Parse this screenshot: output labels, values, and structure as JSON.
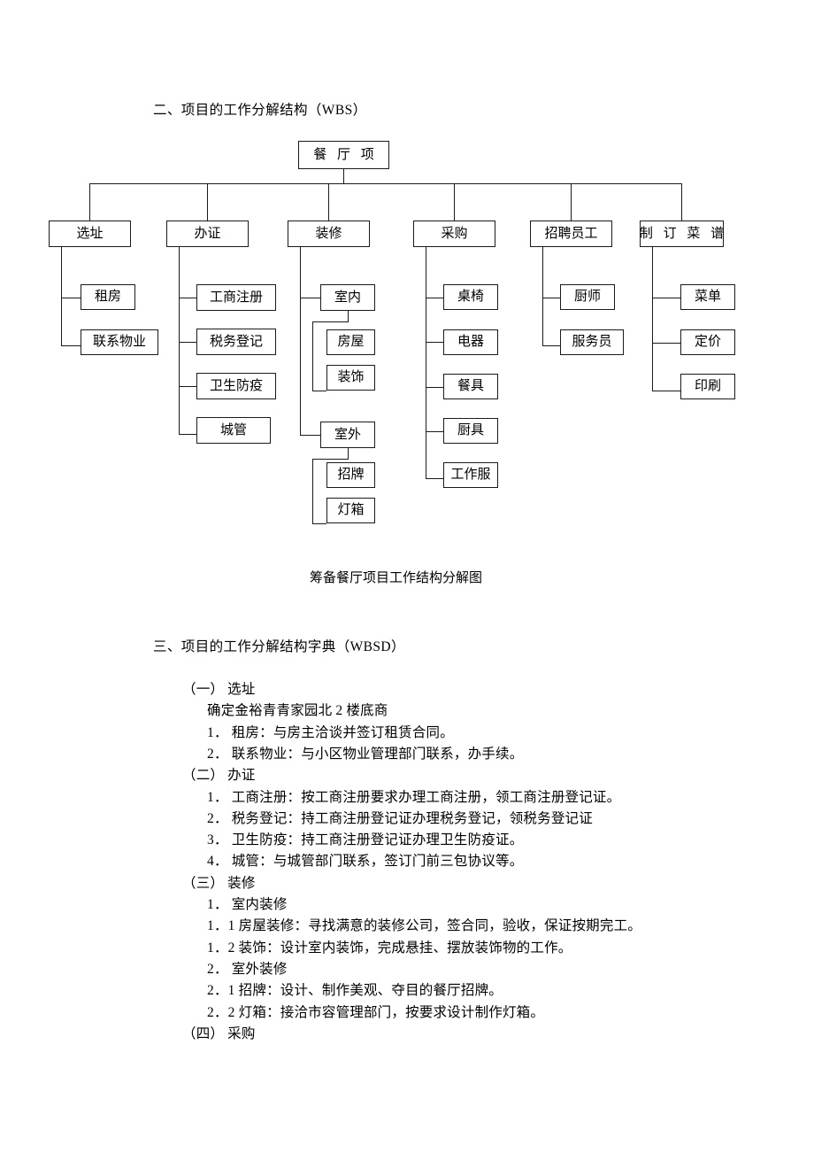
{
  "document": {
    "section_wbs_heading": "二、项目的工作分解结构（WBS）",
    "chart_caption": "筹备餐厅项目工作结构分解图",
    "section_wbsd_heading": "三、项目的工作分解结构字典（WBSD）"
  },
  "wbs": {
    "root": {
      "label": "餐 厅 项"
    },
    "level2": [
      {
        "label": "选址"
      },
      {
        "label": "办证"
      },
      {
        "label": "装修"
      },
      {
        "label": "采购"
      },
      {
        "label": "招聘员工"
      },
      {
        "label": "制 订 菜 谱"
      }
    ],
    "xuanzhi_children": [
      {
        "label": "租房"
      },
      {
        "label": "联系物业"
      }
    ],
    "banzheng_children": [
      {
        "label": "工商注册"
      },
      {
        "label": "税务登记"
      },
      {
        "label": "卫生防疫"
      },
      {
        "label": "城管"
      }
    ],
    "zhuangxiu_children": [
      {
        "label": "室内"
      },
      {
        "label": "室外"
      }
    ],
    "shinei_children": [
      {
        "label": "房屋"
      },
      {
        "label": "装饰"
      }
    ],
    "shiwai_children": [
      {
        "label": "招牌"
      },
      {
        "label": "灯箱"
      }
    ],
    "caigou_children": [
      {
        "label": "桌椅"
      },
      {
        "label": "电器"
      },
      {
        "label": "餐具"
      },
      {
        "label": "厨具"
      },
      {
        "label": "工作服"
      }
    ],
    "zhaopin_children": [
      {
        "label": "厨师"
      },
      {
        "label": "服务员"
      }
    ],
    "caipu_children": [
      {
        "label": "菜单"
      },
      {
        "label": "定价"
      },
      {
        "label": "印刷"
      }
    ]
  },
  "wbsd": {
    "lines": [
      {
        "text": "（一）  选址",
        "indent": 0
      },
      {
        "text": "确定金裕青青家园北 2 楼底商",
        "indent": 1
      },
      {
        "text": "1． 租房：与房主洽谈并签订租赁合同。",
        "indent": 1
      },
      {
        "text": "2． 联系物业：与小区物业管理部门联系，办手续。",
        "indent": 1
      },
      {
        "text": "（二）  办证",
        "indent": 0
      },
      {
        "text": "1． 工商注册：按工商注册要求办理工商注册，领工商注册登记证。",
        "indent": 1
      },
      {
        "text": "2． 税务登记：持工商注册登记证办理税务登记，领税务登记证",
        "indent": 1
      },
      {
        "text": "3． 卫生防疫：持工商注册登记证办理卫生防疫证。",
        "indent": 1
      },
      {
        "text": "4． 城管：与城管部门联系，签订门前三包协议等。",
        "indent": 1
      },
      {
        "text": "（三）  装修",
        "indent": 0
      },
      {
        "text": "1． 室内装修",
        "indent": 1
      },
      {
        "text": "1．1   房屋装修：寻找满意的装修公司，签合同，验收，保证按期完工。",
        "indent": 1
      },
      {
        "text": "1．2   装饰：设计室内装饰，完成悬挂、摆放装饰物的工作。",
        "indent": 1
      },
      {
        "text": "2． 室外装修",
        "indent": 1
      },
      {
        "text": "2．1   招牌：设计、制作美观、夺目的餐厅招牌。",
        "indent": 1
      },
      {
        "text": "2．2   灯箱：接洽市容管理部门，按要求设计制作灯箱。",
        "indent": 1
      },
      {
        "text": "（四）  采购",
        "indent": 0
      }
    ]
  }
}
